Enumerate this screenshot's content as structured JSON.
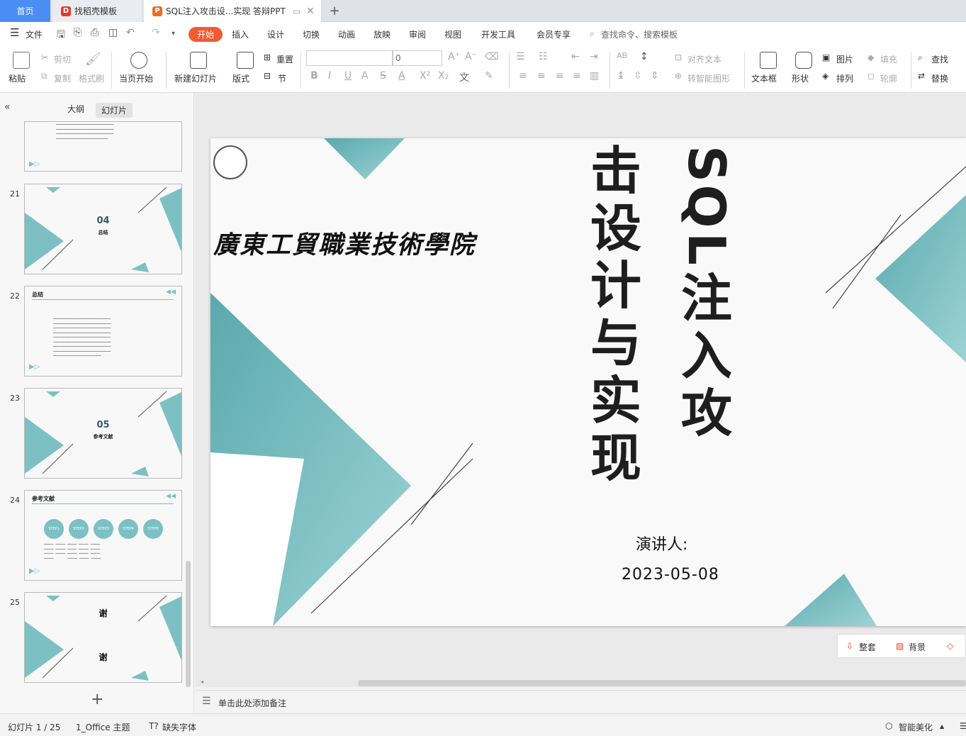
{
  "tabs": {
    "home": "首页",
    "find_template": "找稻壳模板",
    "document": "SQL注入攻击设...实现 答辩PPT",
    "new_tab": "+"
  },
  "menu": {
    "file": "文件",
    "items": [
      "开始",
      "插入",
      "设计",
      "切换",
      "动画",
      "放映",
      "审阅",
      "视图",
      "开发工具",
      "会员专享"
    ],
    "search_placeholder": "查找命令、搜索模板"
  },
  "ribbon": {
    "paste": "粘贴",
    "cut": "剪切",
    "copy": "复制",
    "format_painter": "格式刷",
    "start_current": "当页开始",
    "new_slide": "新建幻灯片",
    "layout": "版式",
    "reset": "重置",
    "section": "节",
    "font_size": "0",
    "align_text": "对齐文本",
    "to_smartart": "转智能图形",
    "textbox": "文本框",
    "shape": "形状",
    "picture": "图片",
    "arrange": "排列",
    "fill": "填充",
    "outline": "轮廓",
    "find": "查找",
    "replace": "替换"
  },
  "sidebar": {
    "tab_outline": "大纲",
    "tab_slides": "幻灯片",
    "slides": [
      {
        "num": "21",
        "big": "04",
        "sub": "总结"
      },
      {
        "num": "22",
        "title": "总结"
      },
      {
        "num": "23",
        "big": "05",
        "sub": "参考文献"
      },
      {
        "num": "24",
        "title": "参考文献",
        "steps": [
          "STEP1",
          "STEP2",
          "STEP3",
          "STEP4",
          "STEP5"
        ]
      },
      {
        "num": "25",
        "big": "谢",
        "big2": "谢"
      }
    ],
    "add": "+"
  },
  "slide": {
    "college": "廣東工貿職業技術學院",
    "title_col1": "SQL注入攻",
    "title_col2": "击设计与实现",
    "presenter_label": "演讲人:",
    "date": "2023-05-08",
    "colors": {
      "teal": "#7cc0c4",
      "teal_dark": "#5aa9ae",
      "bg": "#f9f9f9"
    }
  },
  "float_toolbar": {
    "tidy": "整套",
    "background": "背景"
  },
  "notes_placeholder": "单击此处添加备注",
  "status": {
    "slide_counter": "幻灯片 1 / 25",
    "theme": "1_Office 主题",
    "missing_font": "缺失字体",
    "smart_beautify": "智能美化"
  }
}
